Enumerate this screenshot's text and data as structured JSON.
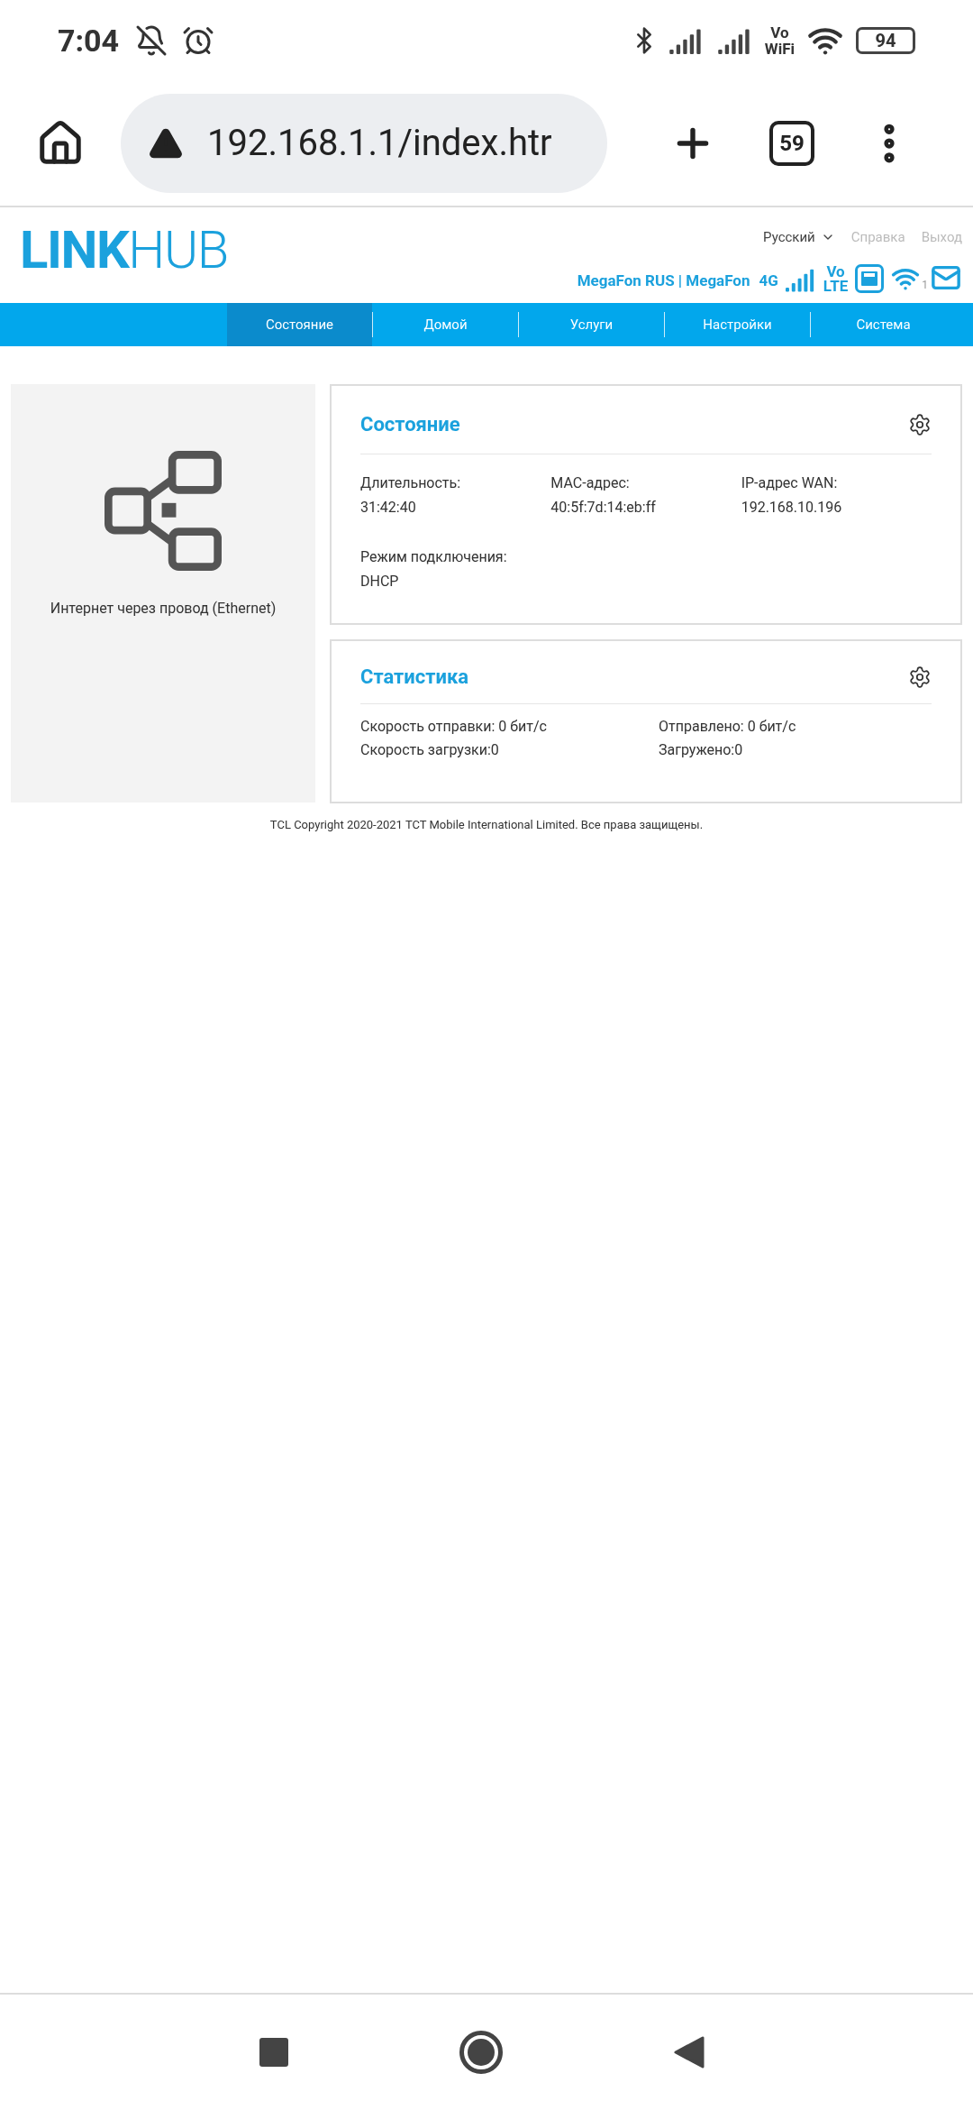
{
  "status_bar": {
    "time": "7:04",
    "vowifi": [
      "Vo",
      "WiFi"
    ],
    "battery": "94"
  },
  "browser": {
    "url": "192.168.1.1/index.htr",
    "tab_count": "59"
  },
  "header": {
    "logo": {
      "bold": "LINK",
      "light": "HUB"
    },
    "language": "Русский",
    "links": [
      "Справка",
      "Выход"
    ],
    "carrier": "MegaFon RUS | MegaFon",
    "network": "4G",
    "volte": [
      "Vo",
      "LTE"
    ],
    "wifi_clients": "1"
  },
  "nav": [
    {
      "label": "Состояние",
      "selected": true
    },
    {
      "label": "Домой",
      "selected": false
    },
    {
      "label": "Услуги",
      "selected": false
    },
    {
      "label": "Настройки",
      "selected": false
    },
    {
      "label": "Система",
      "selected": false
    }
  ],
  "connection_panel": {
    "label": "Интернет через провод (Ethernet)"
  },
  "status_card": {
    "title": "Состояние",
    "fields": [
      {
        "label": "Длительность:",
        "value": "31:42:40"
      },
      {
        "label": "MAC-адрес:",
        "value": "40:5f:7d:14:eb:ff"
      },
      {
        "label": "IP-адрес WAN:",
        "value": "192.168.10.196"
      },
      {
        "label": "Режим подключения:",
        "value": "DHCP"
      }
    ]
  },
  "stats_card": {
    "title": "Статистика",
    "items": [
      "Скорость отправки: 0 бит/с",
      "Отправлено: 0 бит/с",
      "Скорость загрузки:0",
      "Загружено:0"
    ]
  },
  "footer": "TCL Copyright 2020-2021 TCT Mobile International Limited. Все права защищены."
}
